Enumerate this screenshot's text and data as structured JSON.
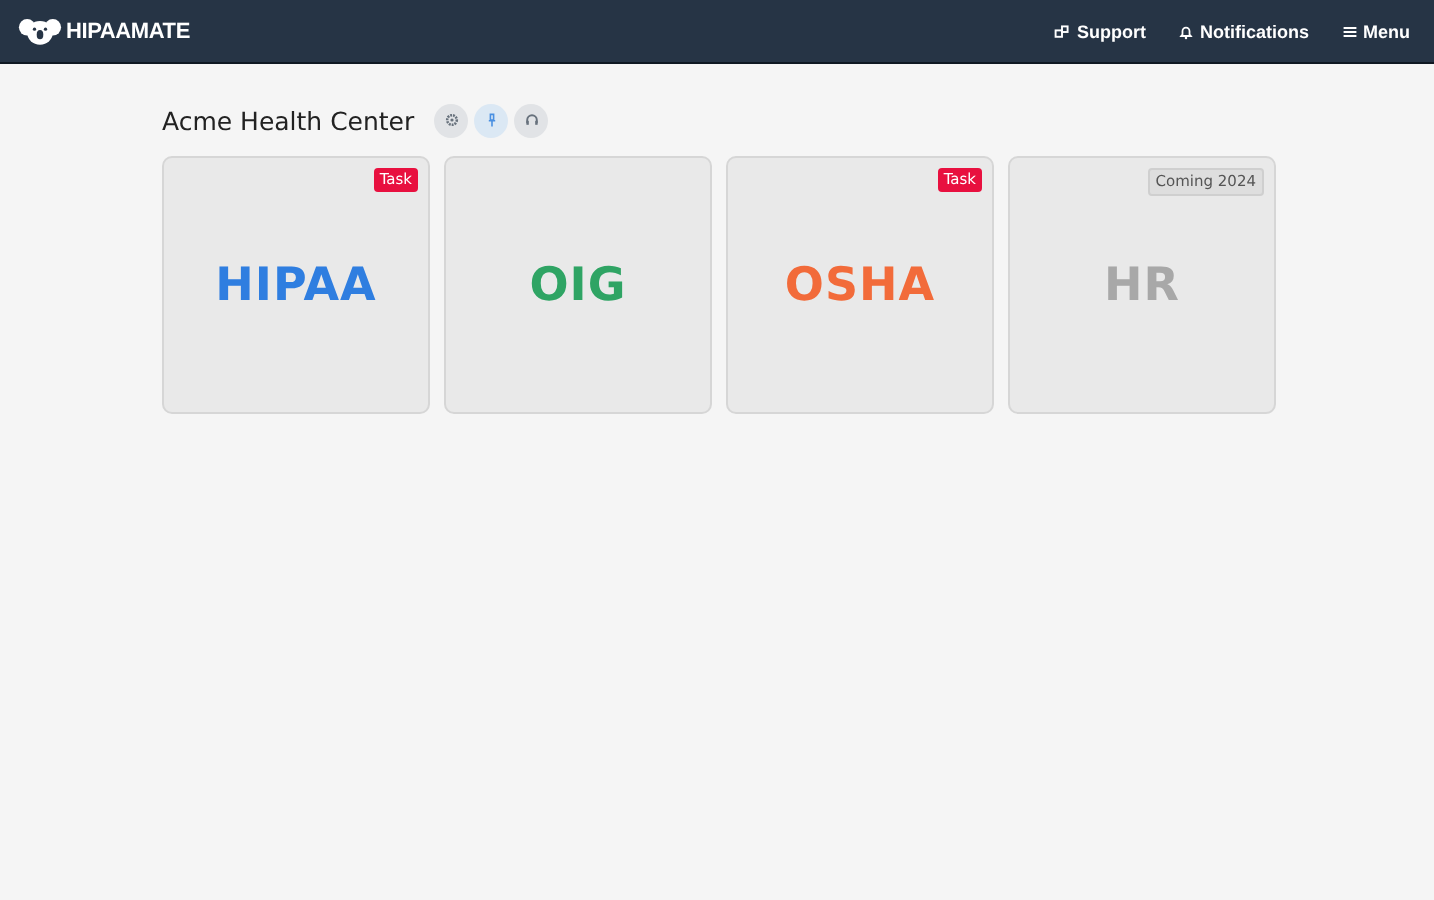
{
  "header": {
    "logo": "HIPAAMATE",
    "nav": [
      {
        "kind": "support",
        "label": "Support"
      },
      {
        "kind": "notifications",
        "label": "Notifications"
      },
      {
        "kind": "menu",
        "label": "Menu"
      }
    ]
  },
  "page": {
    "title": "Acme Health Center",
    "actions": [
      {
        "kind": "settings",
        "selected": false
      },
      {
        "kind": "pin",
        "selected": true
      },
      {
        "kind": "support",
        "selected": false
      }
    ]
  },
  "cards": [
    {
      "label": "HIPAA",
      "color": "#2f7ee0",
      "badge": {
        "kind": "task",
        "text": "Task"
      }
    },
    {
      "label": "OIG",
      "color": "#2fa464"
    },
    {
      "label": "OSHA",
      "color": "#f26b3a",
      "badge": {
        "kind": "task",
        "text": "Task"
      }
    },
    {
      "label": "HR",
      "color": "#a8a8a8",
      "badge": {
        "kind": "coming",
        "text": "Coming 2024"
      }
    }
  ]
}
